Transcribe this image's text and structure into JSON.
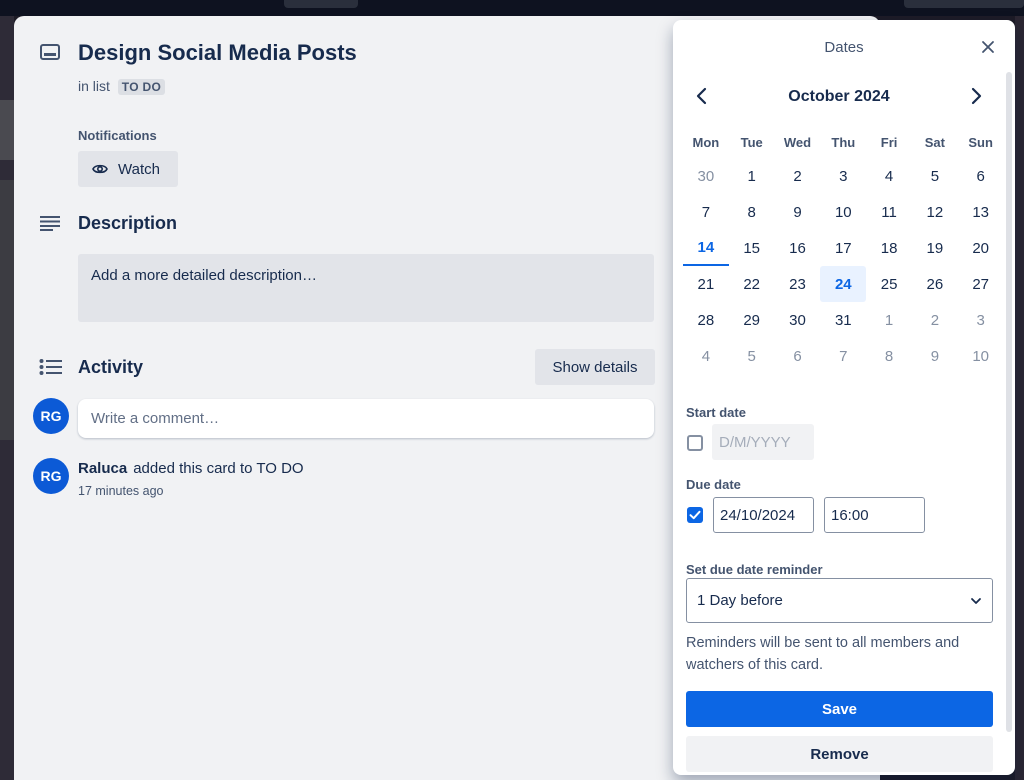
{
  "card": {
    "title": "Design Social Media Posts",
    "in_list_prefix": "in list",
    "list_name": "TO DO",
    "notifications_label": "Notifications",
    "watch_label": "Watch",
    "description_heading": "Description",
    "description_placeholder": "Add a more detailed description…",
    "activity_heading": "Activity",
    "show_details_label": "Show details",
    "comment_placeholder": "Write a comment…",
    "user_initials": "RG",
    "activity": [
      {
        "initials": "RG",
        "user": "Raluca",
        "action": "added this card to TO DO",
        "time": "17 minutes ago"
      }
    ]
  },
  "dates_popover": {
    "title": "Dates",
    "month_label": "October 2024",
    "weekdays": [
      "Mon",
      "Tue",
      "Wed",
      "Thu",
      "Fri",
      "Sat",
      "Sun"
    ],
    "weeks": [
      [
        "30",
        "1",
        "2",
        "3",
        "4",
        "5",
        "6"
      ],
      [
        "7",
        "8",
        "9",
        "10",
        "11",
        "12",
        "13"
      ],
      [
        "14",
        "15",
        "16",
        "17",
        "18",
        "19",
        "20"
      ],
      [
        "21",
        "22",
        "23",
        "24",
        "25",
        "26",
        "27"
      ],
      [
        "28",
        "29",
        "30",
        "31",
        "1",
        "2",
        "3"
      ],
      [
        "4",
        "5",
        "6",
        "7",
        "8",
        "9",
        "10"
      ]
    ],
    "other_month": [
      [
        true,
        false,
        false,
        false,
        false,
        false,
        false
      ],
      [
        false,
        false,
        false,
        false,
        false,
        false,
        false
      ],
      [
        false,
        false,
        false,
        false,
        false,
        false,
        false
      ],
      [
        false,
        false,
        false,
        false,
        false,
        false,
        false
      ],
      [
        false,
        false,
        false,
        false,
        true,
        true,
        true
      ],
      [
        true,
        true,
        true,
        true,
        true,
        true,
        true
      ]
    ],
    "today": "14",
    "selected": "24",
    "start_date_label": "Start date",
    "start_date_checked": false,
    "start_date_placeholder": "D/M/YYYY",
    "due_date_label": "Due date",
    "due_date_checked": true,
    "due_date_value": "24/10/2024",
    "due_time_value": "16:00",
    "reminder_label": "Set due date reminder",
    "reminder_value": "1 Day before",
    "reminder_note": "Reminders will be sent to all members and watchers of this card.",
    "save_label": "Save",
    "remove_label": "Remove"
  },
  "colors": {
    "accent": "#0c66e4",
    "avatar": "#0c5ad6",
    "selected_bg": "#e9f2ff"
  }
}
